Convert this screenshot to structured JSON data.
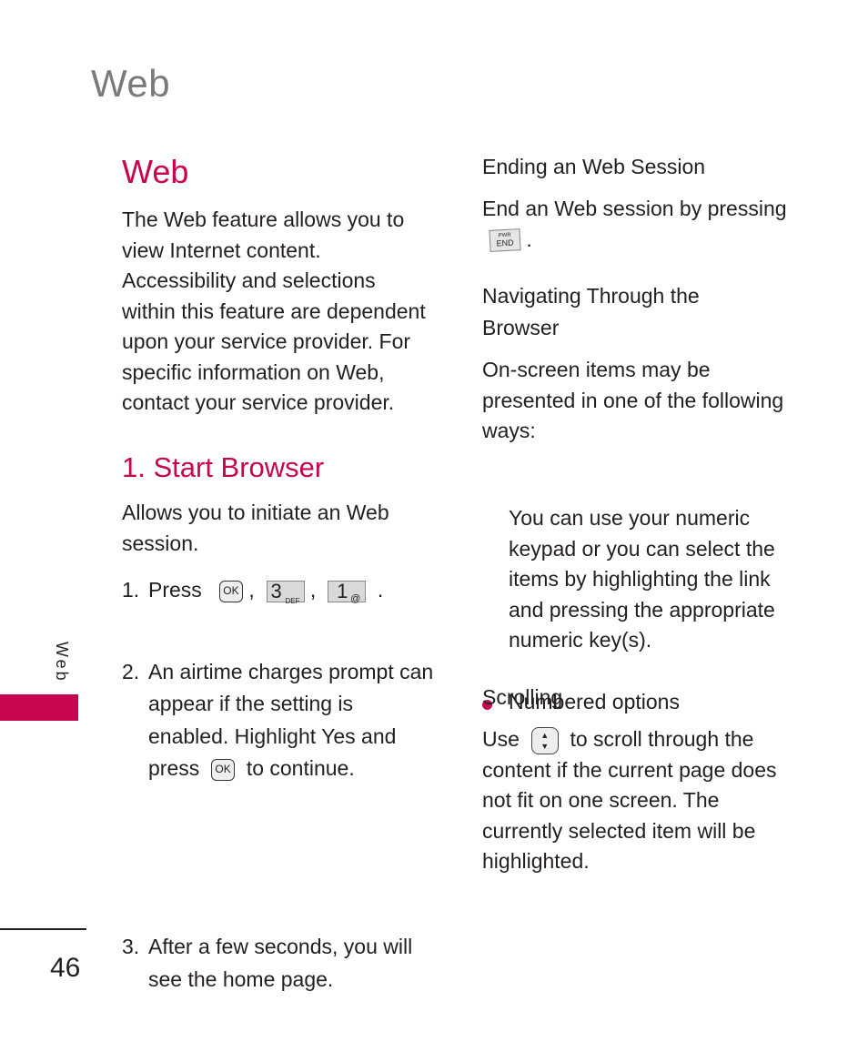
{
  "running_head": "Web",
  "side_tab": {
    "label": "Web",
    "color": "#c8064f"
  },
  "page_number": "46",
  "accent_color": "#c8064f",
  "left": {
    "title": "Web",
    "intro": [
      "The Web feature allows you to",
      "view Internet content.",
      "Accessibility and selections",
      "within this feature are dependent",
      "upon your service provider. For",
      "specific information on Web,",
      "contact your service provider."
    ],
    "section": {
      "title": "1. Start Browser",
      "desc": [
        "Allows you to initiate an Web",
        "session."
      ],
      "steps": [
        {
          "num": "1.",
          "text_before": "Press",
          "keys": [
            {
              "type": "ok",
              "label": "OK"
            },
            {
              "type": "num",
              "big": "3",
              "small": "DEF"
            },
            {
              "type": "num",
              "big": "1",
              "small": "@"
            }
          ]
        },
        {
          "num": "2.",
          "line1": "An airtime charges prompt can",
          "line2": "appear if the setting is",
          "line3_before": "enabled. Highlight",
          "line3_bold": "Yes",
          "line3_after": "and",
          "line4_before": "press",
          "line4_key": "OK",
          "line4_after": "to continue."
        },
        {
          "num": "3.",
          "line1": "After a few seconds, you will",
          "line2": "see the home page."
        }
      ]
    }
  },
  "right": {
    "ending": {
      "title": "Ending an Web Session",
      "text": "End an Web session by pressing",
      "key_top": "PWR",
      "key_main": "END"
    },
    "navigating": {
      "title_line1": "Navigating Through the",
      "title_line2": "Browser",
      "text": [
        "On-screen items may be",
        "presented in one of the following",
        "ways:"
      ],
      "bullet": {
        "title": "Numbered options",
        "text": [
          "You can use your numeric",
          "keypad or you can select the",
          "items by highlighting the link",
          "and pressing the appropriate",
          "numeric key(s)."
        ]
      }
    },
    "scrolling": {
      "title": "Scrolling",
      "use": "Use",
      "after_key": "to scroll through the",
      "text": [
        "content if the current page does",
        "not fit on one screen. The",
        "currently selected item will be",
        "highlighted."
      ],
      "key_up": "▲",
      "key_down": "▼"
    }
  }
}
